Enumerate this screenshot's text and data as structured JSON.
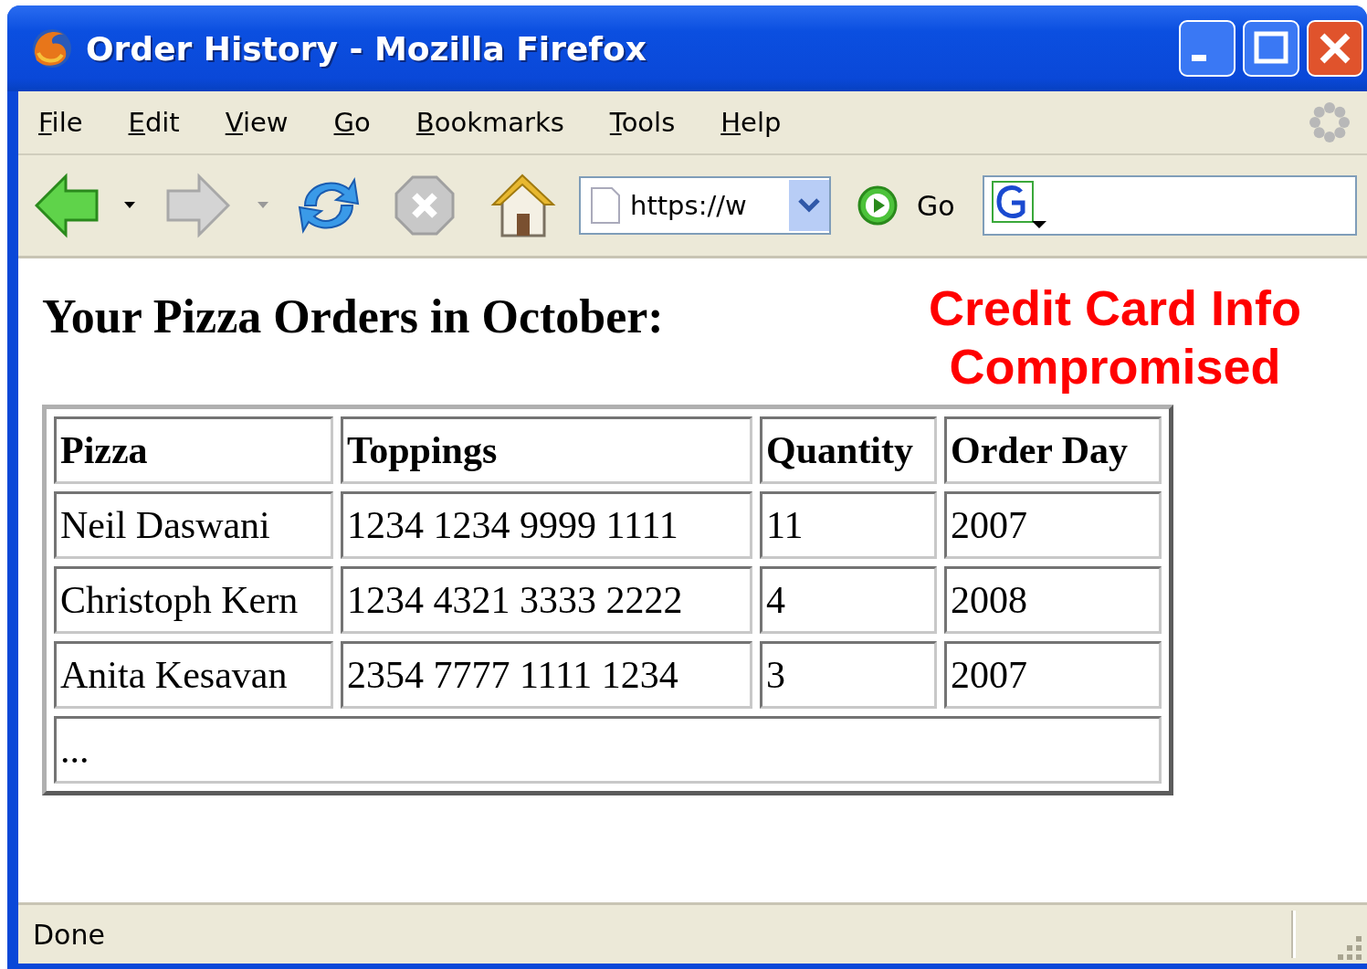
{
  "window": {
    "title": "Order History - Mozilla Firefox"
  },
  "menu": [
    {
      "label": "File"
    },
    {
      "label": "Edit"
    },
    {
      "label": "View"
    },
    {
      "label": "Go"
    },
    {
      "label": "Bookmarks"
    },
    {
      "label": "Tools"
    },
    {
      "label": "Help"
    }
  ],
  "toolbar": {
    "url": "https://w",
    "go_label": "Go"
  },
  "page": {
    "heading": "Your Pizza Orders in October:",
    "annotation": "Credit Card Info Compromised",
    "table": {
      "columns": [
        "Pizza",
        "Toppings",
        "Quantity",
        "Order Day"
      ],
      "rows": [
        [
          "Neil Daswani",
          "1234 1234 9999 1111",
          "11",
          "2007"
        ],
        [
          "Christoph Kern",
          "1234 4321 3333 2222",
          "4",
          "2008"
        ],
        [
          "Anita Kesavan",
          "2354 7777 1111 1234",
          "3",
          "2007"
        ]
      ],
      "footer": "..."
    }
  },
  "status_bar": {
    "text": "Done"
  }
}
